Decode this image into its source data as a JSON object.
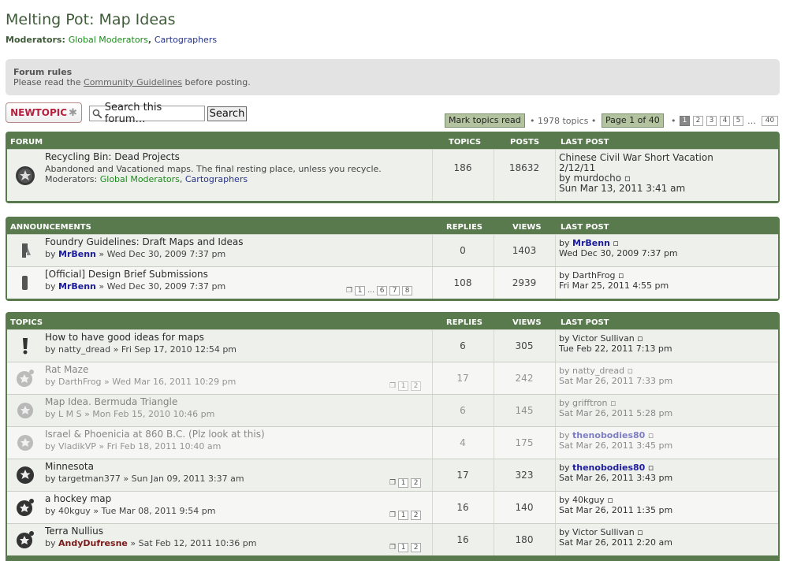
{
  "page": {
    "title": "Melting Pot: Map Ideas",
    "moderators_label": "Moderators:",
    "moderators": [
      "Global Moderators",
      "Cartographers"
    ]
  },
  "rules": {
    "heading": "Forum rules",
    "text_pre": "Please read the ",
    "link": "Community Guidelines",
    "text_post": " before posting."
  },
  "toolbar": {
    "new_topic": "NEWTOPIC",
    "search_placeholder": "Search this forum…",
    "search_button": "Search",
    "mark_read": "Mark topics read",
    "topic_count": "• 1978 topics •",
    "page_label": "Page 1 of 40",
    "pages": [
      "1",
      "2",
      "3",
      "4",
      "5"
    ],
    "ellipsis": "…",
    "last_page": "40"
  },
  "forum_block": {
    "headers": {
      "name": "FORUM",
      "topics": "TOPICS",
      "posts": "POSTS",
      "last": "LAST POST"
    },
    "row": {
      "title": "Recycling Bin: Dead Projects",
      "desc": "Abandoned and Vacationed maps. The final resting place, unless you recycle.",
      "mods_label": "Moderators:",
      "mods": [
        "Global Moderators",
        "Cartographers"
      ],
      "topics": "186",
      "posts": "18632",
      "last_title": "Chinese Civil War Short Vacation",
      "last_title2": "2/12/11",
      "last_by": "by murdocho",
      "last_date": "Sun Mar 13, 2011 3:41 am"
    }
  },
  "ann_block": {
    "headers": {
      "name": "ANNOUNCEMENTS",
      "replies": "REPLIES",
      "views": "VIEWS",
      "last": "LAST POST"
    },
    "rows": [
      {
        "title": "Foundry Guidelines: Draft Maps and Ideas",
        "by": "by ",
        "author": "MrBenn",
        "date": " » Wed Dec 30, 2009 7:37 pm",
        "replies": "0",
        "views": "1403",
        "last_by": "by ",
        "last_author": "MrBenn",
        "last_date": "Wed Dec 30, 2009 7:37 pm"
      },
      {
        "title": "[Official] Design Brief Submissions",
        "by": "by ",
        "author": "MrBenn",
        "date": " » Wed Dec 30, 2009 7:37 pm",
        "replies": "108",
        "views": "2939",
        "last_by": "by DarthFrog",
        "last_date": "Fri Mar 25, 2011 4:55 pm",
        "pages": [
          "1",
          "…",
          "6",
          "7",
          "8"
        ]
      }
    ]
  },
  "topics_block": {
    "headers": {
      "name": "TOPICS",
      "replies": "REPLIES",
      "views": "VIEWS",
      "last": "LAST POST"
    },
    "rows": [
      {
        "title": "How to have good ideas for maps",
        "meta": "by natty_dread » Fri Sep 17, 2010 12:54 pm",
        "replies": "6",
        "views": "305",
        "last_by": "by Victor Sullivan",
        "last_date": "Tue Feb 22, 2011 7:13 pm"
      },
      {
        "title": "Rat Maze",
        "meta": "by DarthFrog » Wed Mar 16, 2011 10:29 pm",
        "replies": "17",
        "views": "242",
        "last_by": "by natty_dread",
        "last_date": "Sat Mar 26, 2011 7:33 pm",
        "pages": [
          "1",
          "2"
        ]
      },
      {
        "title": "Map Idea. Bermuda Triangle",
        "meta": "by L M S » Mon Feb 15, 2010 10:46 pm",
        "replies": "6",
        "views": "145",
        "last_by": "by grifftron",
        "last_date": "Sat Mar 26, 2011 5:28 pm"
      },
      {
        "title": "Israel & Phoenicia at 860 B.C. (Plz look at this)",
        "meta": "by VladikVP » Fri Feb 18, 2011 10:40 am",
        "replies": "4",
        "views": "175",
        "last_by": "by ",
        "last_author": "thenobodies80",
        "last_date": "Sat Mar 26, 2011 3:45 pm"
      },
      {
        "title": "Minnesota",
        "meta": "by targetman377 » Sun Jan 09, 2011 3:37 am",
        "replies": "17",
        "views": "323",
        "last_by": "by ",
        "last_author": "thenobodies80",
        "last_date": "Sat Mar 26, 2011 3:43 pm",
        "pages": [
          "1",
          "2"
        ]
      },
      {
        "title": "a hockey map",
        "meta": "by 40kguy » Tue Mar 08, 2011 9:54 pm",
        "replies": "16",
        "views": "140",
        "last_by": "by 40kguy",
        "last_date": "Sat Mar 26, 2011 1:35 pm",
        "pages": [
          "1",
          "2"
        ]
      },
      {
        "title": "Terra Nullius",
        "by": "by ",
        "author": "AndyDufresne",
        "date": " » Sat Feb 12, 2011 10:36 pm",
        "replies": "16",
        "views": "180",
        "last_by": "by Victor Sullivan",
        "last_date": "Sat Mar 26, 2011 2:20 am",
        "pages": [
          "1",
          "2"
        ]
      }
    ]
  },
  "colors": {
    "green_header": "#587a4d",
    "accent_red": "#b5213e",
    "author_blue": "#1c1c9c"
  }
}
